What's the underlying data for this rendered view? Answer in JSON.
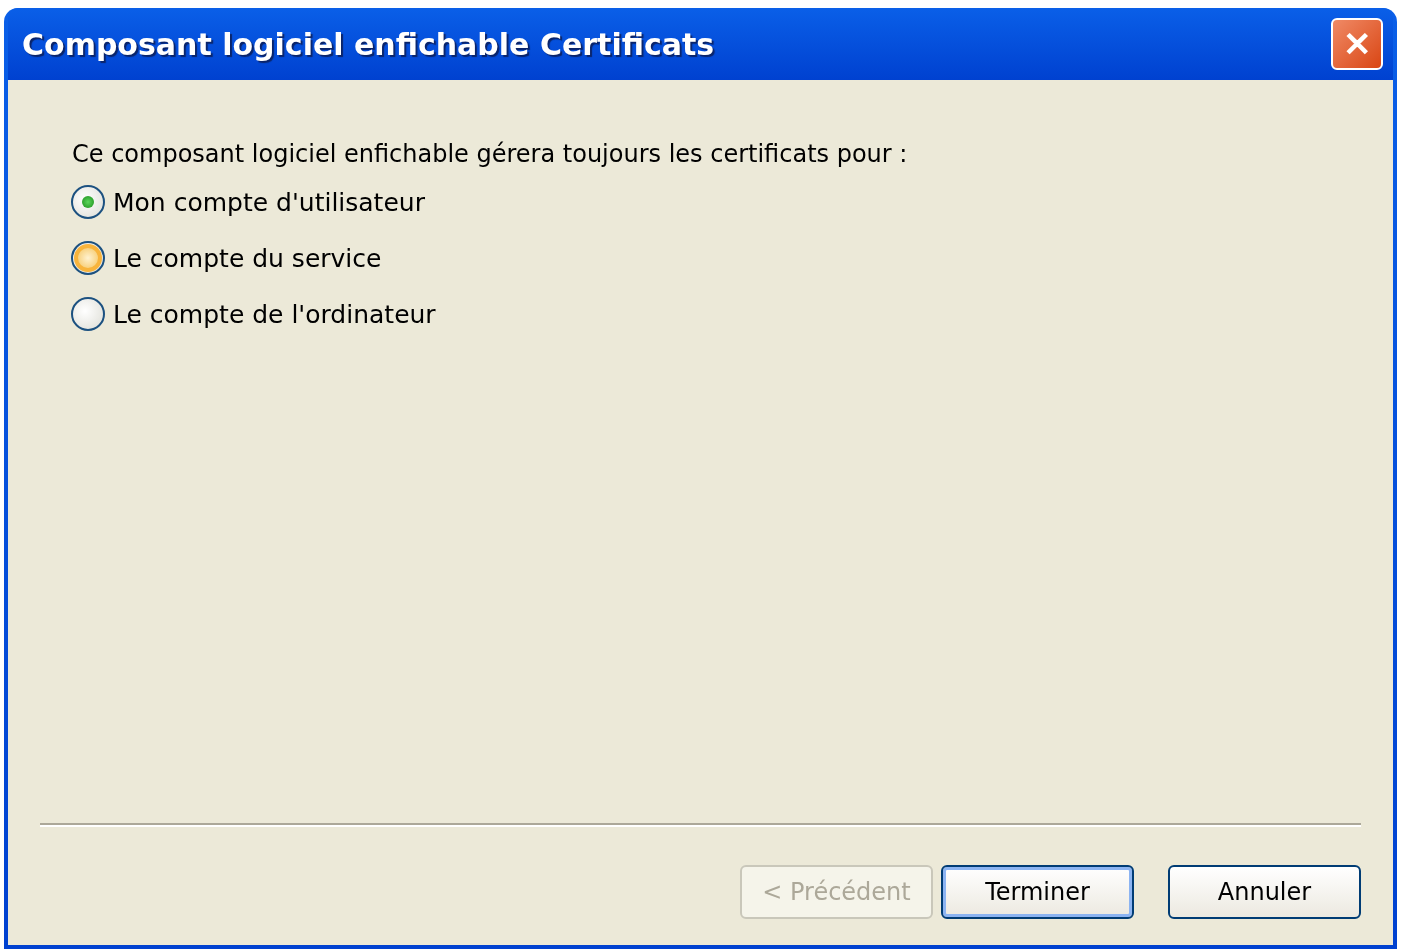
{
  "window": {
    "title": "Composant logiciel enfichable Certificats",
    "close": "✕"
  },
  "prompt": "Ce composant logiciel enfichable gérera toujours les certificats pour :",
  "options": [
    {
      "label": "Mon compte d'utilisateur",
      "selected": true,
      "hovered": false
    },
    {
      "label": "Le compte du service",
      "selected": false,
      "hovered": true
    },
    {
      "label": "Le compte de l'ordinateur",
      "selected": false,
      "hovered": false
    }
  ],
  "buttons": [
    {
      "label": "< Précédent",
      "disabled": true,
      "default": false
    },
    {
      "label": "Terminer",
      "disabled": false,
      "default": true
    },
    {
      "label": "Annuler",
      "disabled": false,
      "default": false
    }
  ]
}
